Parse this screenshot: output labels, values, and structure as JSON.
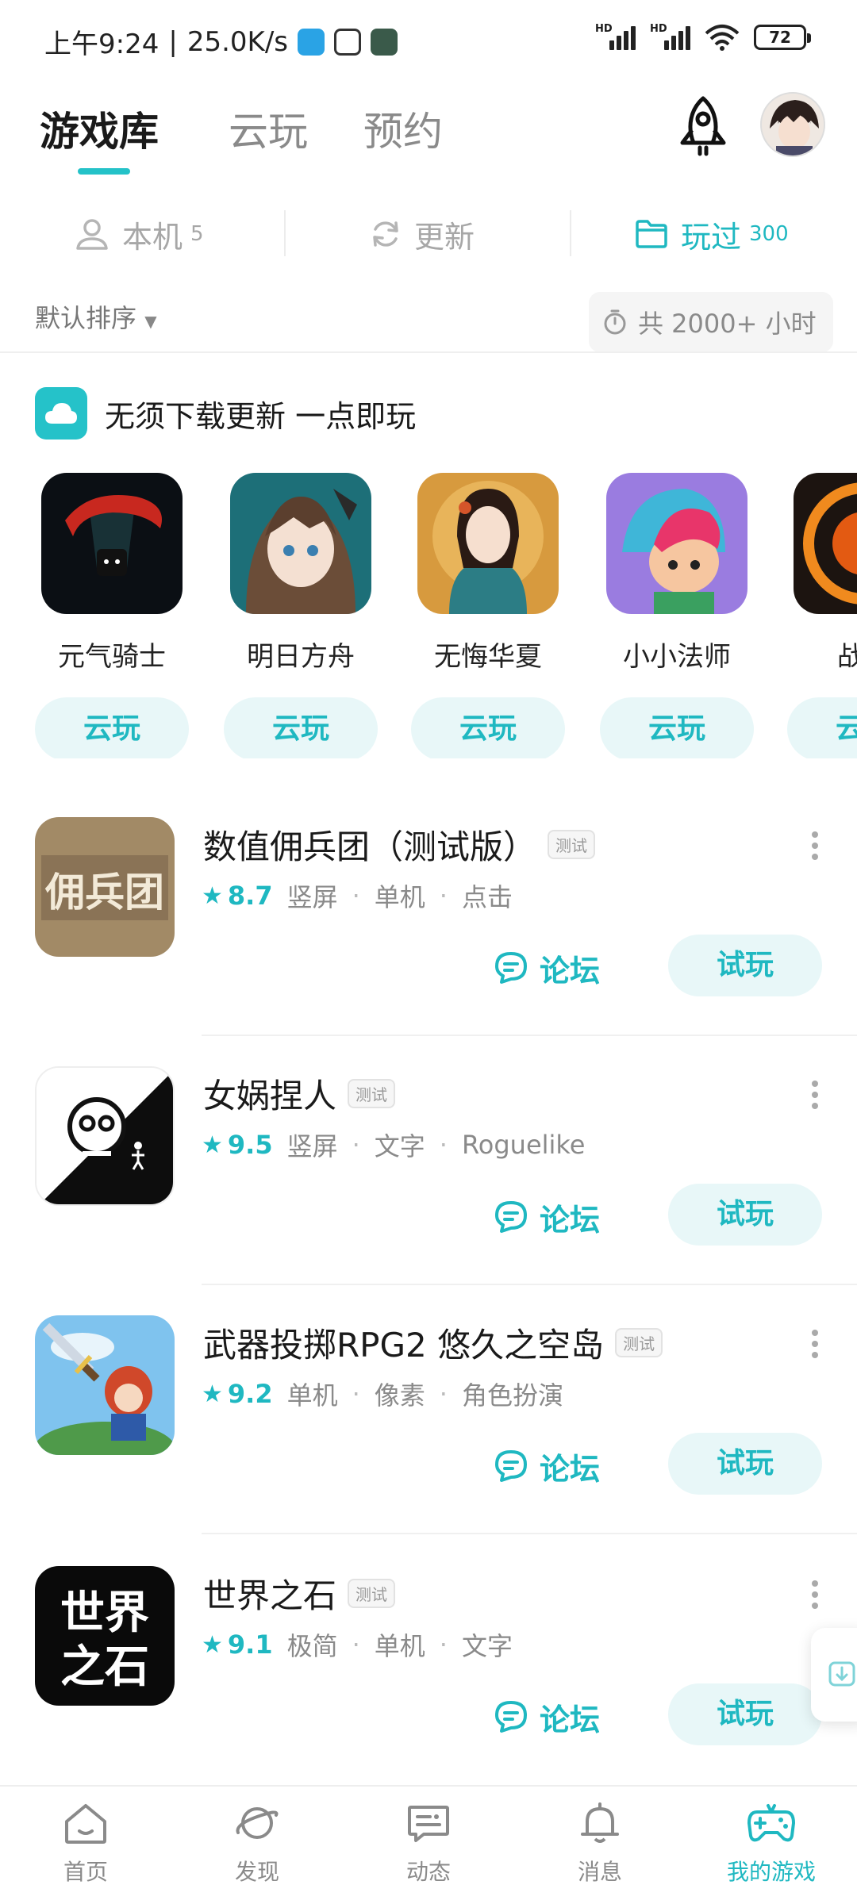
{
  "status_bar": {
    "time": "上午9:24",
    "speed": "25.0K/s",
    "battery": "72",
    "signal_label": "HD"
  },
  "header": {
    "tabs": [
      {
        "label": "游戏库",
        "active": true
      },
      {
        "label": "云玩",
        "active": false
      },
      {
        "label": "预约",
        "active": false
      }
    ]
  },
  "subtabs": {
    "local": {
      "label": "本机",
      "count": "5"
    },
    "update": {
      "label": "更新"
    },
    "played": {
      "label": "玩过",
      "count": "300"
    }
  },
  "sort": {
    "label": "默认排序",
    "total_hours": "共 2000+ 小时"
  },
  "cloud_section": {
    "title": "无须下载更新 一点即玩",
    "button_label": "云玩",
    "games": [
      {
        "name": "元气骑士"
      },
      {
        "name": "明日方舟"
      },
      {
        "name": "无悔华夏"
      },
      {
        "name": "小小法师"
      },
      {
        "name": "战魂"
      }
    ]
  },
  "games": [
    {
      "title": "数值佣兵团（测试版）",
      "tag": "测试",
      "score": "8.7",
      "tags": [
        "竖屏",
        "单机",
        "点击"
      ],
      "icon_text": "佣兵团"
    },
    {
      "title": "女娲捏人",
      "tag": "测试",
      "score": "9.5",
      "tags": [
        "竖屏",
        "文字",
        "Roguelike"
      ]
    },
    {
      "title": "武器投掷RPG2 悠久之空岛",
      "tag": "测试",
      "score": "9.2",
      "tags": [
        "单机",
        "像素",
        "角色扮演"
      ]
    },
    {
      "title": "世界之石",
      "tag": "测试",
      "score": "9.1",
      "tags": [
        "极简",
        "单机",
        "文字"
      ],
      "icon_text": [
        "世界",
        "之石"
      ]
    }
  ],
  "actions": {
    "forum": "论坛",
    "try": "试玩"
  },
  "bottom_nav": [
    {
      "label": "首页",
      "icon": "home-icon"
    },
    {
      "label": "发现",
      "icon": "planet-icon"
    },
    {
      "label": "动态",
      "icon": "chat-icon"
    },
    {
      "label": "消息",
      "icon": "bell-icon"
    },
    {
      "label": "我的游戏",
      "icon": "gamepad-icon",
      "active": true
    }
  ],
  "colors": {
    "accent": "#1fb8c1",
    "accent_bg": "#e8f7f8",
    "text_primary": "#1a1a1a",
    "text_secondary": "#8a8a8a"
  }
}
